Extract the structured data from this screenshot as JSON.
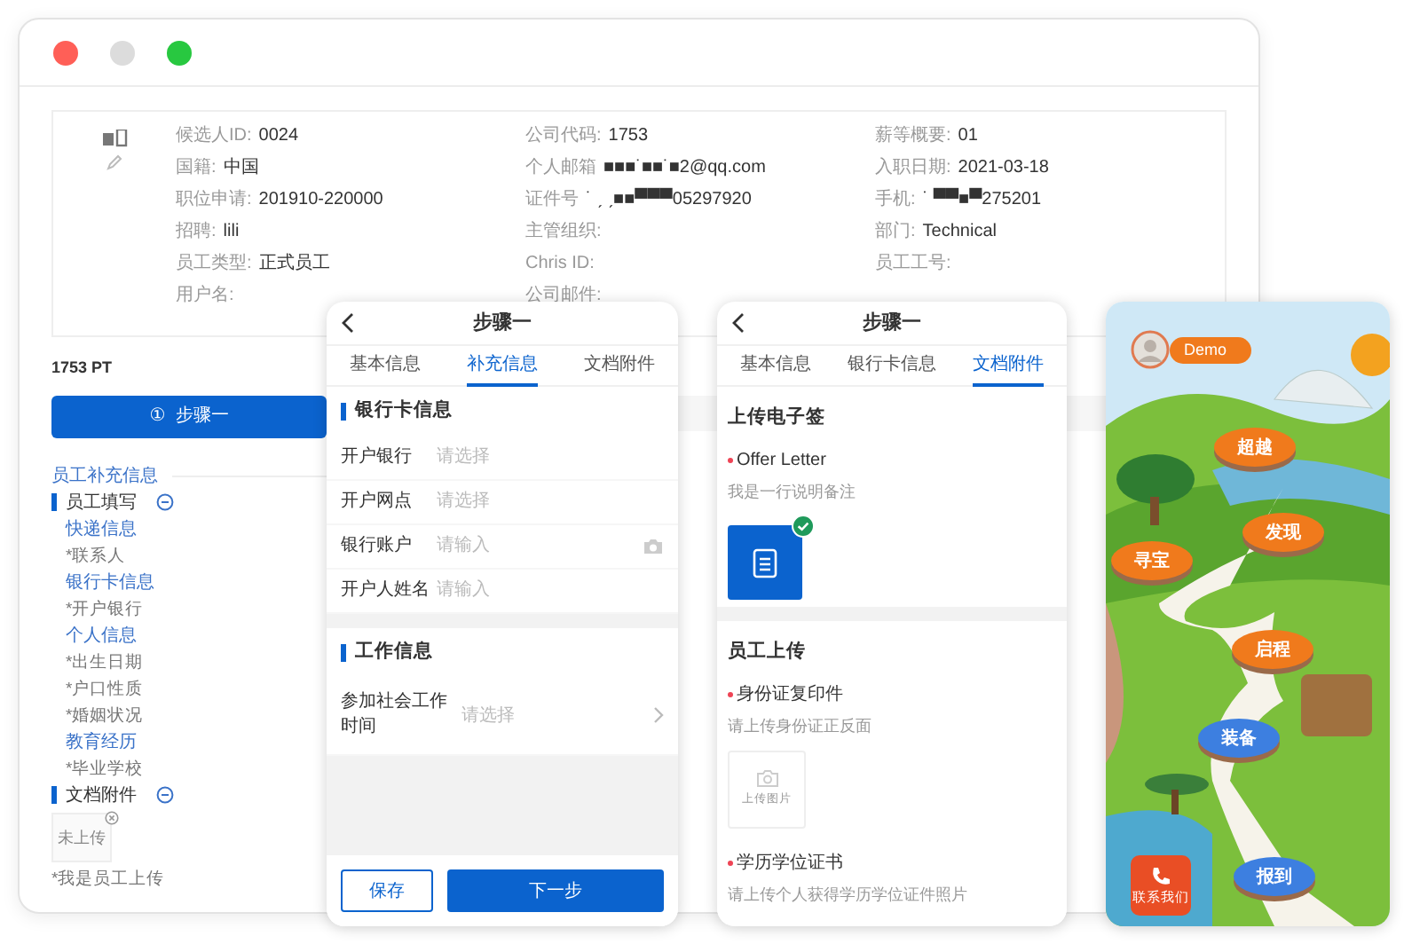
{
  "window": {
    "controls": [
      {
        "color": "#ff5f57"
      },
      {
        "color": "#dcdcdc"
      },
      {
        "color": "#28c840"
      }
    ]
  },
  "profile": {
    "fields": [
      {
        "label": "候选人ID:",
        "value": "0024"
      },
      {
        "label": "公司代码:",
        "value": "1753"
      },
      {
        "label": "薪等概要:",
        "value": "01"
      },
      {
        "label": "国籍:",
        "value": "中国"
      },
      {
        "label": "个人邮箱",
        "value": "■■■˙■■˙■2@qq.com"
      },
      {
        "label": "入职日期:",
        "value": "2021-03-18"
      },
      {
        "label": "职位申请:",
        "value": "201910-220000"
      },
      {
        "label": "证件号",
        "value": "˙  ˏ ˏ■■▀▀▀05297920"
      },
      {
        "label": "手机:",
        "value": "˙ ▀▀■▀275201"
      },
      {
        "label": "招聘:",
        "value": "lili"
      },
      {
        "label": "主管组织:"
      },
      {
        "label": "部门:",
        "value": "Technical"
      },
      {
        "label": "员工类型:",
        "value": "正式员工"
      },
      {
        "label": "Chris ID:"
      },
      {
        "label": "员工工号:"
      },
      {
        "label": "用户名:"
      },
      {
        "label": "公司邮件:"
      }
    ]
  },
  "code_label": "1753 PT",
  "step_button": {
    "icon": "①",
    "label": "步骤一"
  },
  "sidebar": {
    "title": "员工补充信息",
    "sections": [
      {
        "label": "员工填写",
        "expanded": true,
        "children": [
          {
            "kind": "group",
            "label": "快递信息"
          },
          {
            "kind": "field",
            "label": "*联系人"
          },
          {
            "kind": "group",
            "label": "银行卡信息"
          },
          {
            "kind": "field",
            "label": "*开户银行"
          },
          {
            "kind": "group",
            "label": "个人信息"
          },
          {
            "kind": "field",
            "label": "*出生日期"
          },
          {
            "kind": "field",
            "label": "*户口性质"
          },
          {
            "kind": "field",
            "label": "*婚姻状况"
          },
          {
            "kind": "group",
            "label": "教育经历"
          },
          {
            "kind": "field",
            "label": "*毕业学校"
          }
        ]
      },
      {
        "label": "文档附件",
        "expanded": true,
        "children": [
          {
            "kind": "upload",
            "label": "未上传"
          },
          {
            "kind": "note",
            "label": "*我是员工上传"
          }
        ]
      }
    ]
  },
  "bank_form_phone": {
    "title": "步骤一",
    "tabs": [
      {
        "label": "基本信息",
        "selected": false
      },
      {
        "label": "补充信息",
        "selected": true
      },
      {
        "label": "文档附件",
        "selected": false
      }
    ],
    "sections": [
      {
        "title": "银行卡信息",
        "rows": [
          {
            "kind": "select",
            "label": "开户银行",
            "placeholder": "请选择"
          },
          {
            "kind": "select",
            "label": "开户网点",
            "placeholder": "请选择"
          },
          {
            "kind": "camera",
            "label": "银行账户",
            "placeholder": "请输入"
          },
          {
            "kind": "input",
            "label": "开户人姓名",
            "placeholder": "请输入"
          }
        ]
      },
      {
        "title": "工作信息",
        "rows": [
          {
            "kind": "picker",
            "label": "参加社会工作时间",
            "placeholder": "请选择"
          }
        ]
      }
    ],
    "buttons": [
      {
        "kind": "outline",
        "label": "保存"
      },
      {
        "kind": "primary",
        "label": "下一步"
      }
    ]
  },
  "attachments_phone": {
    "title": "步骤一",
    "tabs": [
      {
        "label": "基本信息",
        "selected": false
      },
      {
        "label": "银行卡信息",
        "selected": false
      },
      {
        "label": "文档附件",
        "selected": true
      }
    ],
    "sections": [
      {
        "title": "上传电子签",
        "items": [
          {
            "label": "Offer Letter",
            "required": true,
            "hint": "我是一行说明备注",
            "uploaded": true
          }
        ]
      },
      {
        "title": "员工上传",
        "items": [
          {
            "label": "身份证复印件",
            "required": true,
            "hint": "请上传身份证正反面",
            "uploaded": false,
            "upload_label": "上传图片"
          },
          {
            "label": "学历学位证书",
            "required": true,
            "hint": "请上传个人获得学历学位证件照片"
          }
        ]
      }
    ]
  },
  "game_phone": {
    "user": "Demo",
    "contact_button": "联系我们",
    "stops": [
      {
        "label": "超越",
        "color": "#f07a1c"
      },
      {
        "label": "发现",
        "color": "#f07a1c"
      },
      {
        "label": "寻宝",
        "color": "#f07a1c"
      },
      {
        "label": "启程",
        "color": "#f07a1c"
      },
      {
        "label": "装备",
        "color": "#3d7fe0"
      },
      {
        "label": "报到",
        "color": "#3d7fe0"
      }
    ]
  }
}
